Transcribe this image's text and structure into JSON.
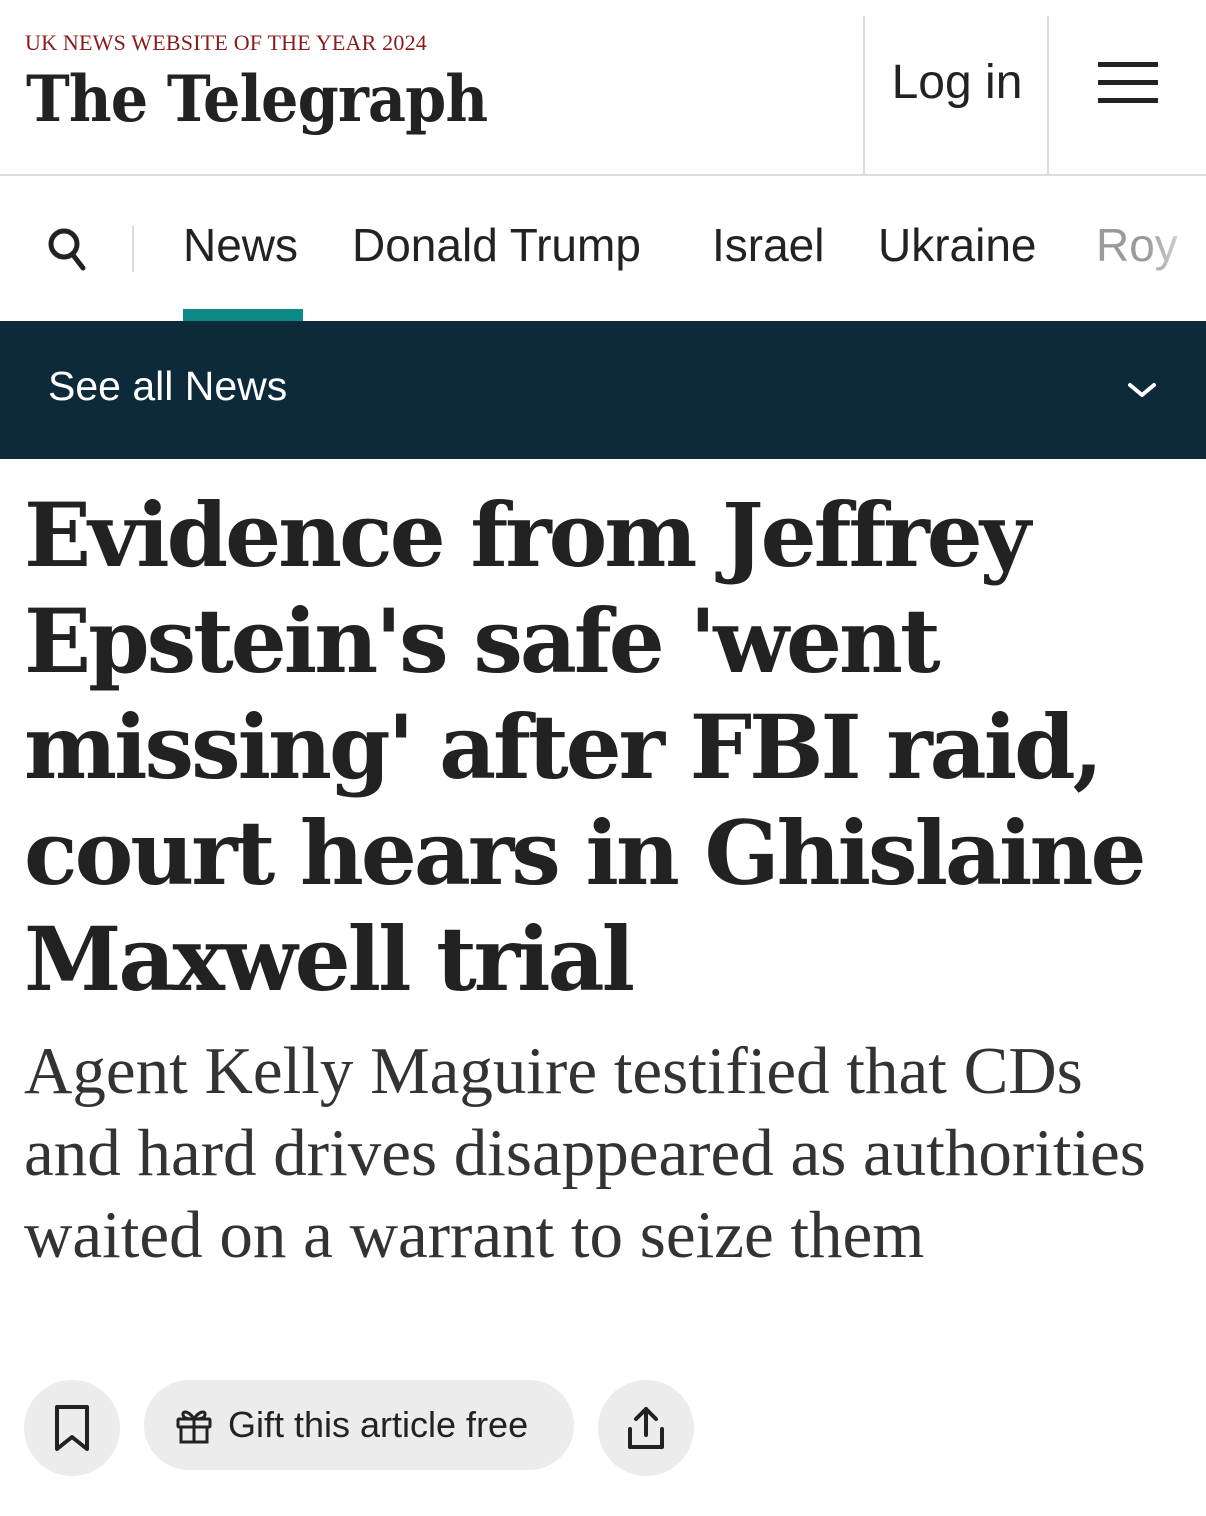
{
  "header": {
    "award": "UK NEWS WEBSITE OF THE YEAR 2024",
    "logo": "The Telegraph",
    "login_label": "Log in",
    "menu_icon": "hamburger-icon"
  },
  "nav": {
    "search_icon": "search-icon",
    "items": [
      {
        "label": "News"
      },
      {
        "label": "Donald Trump"
      },
      {
        "label": "Israel"
      },
      {
        "label": "Ukraine"
      },
      {
        "label": "Roy"
      }
    ],
    "active": "News",
    "accent_color": "#0d8a86"
  },
  "see_all": {
    "label": "See all News",
    "background": "#0d2a3a",
    "icon": "chevron-down-icon"
  },
  "article": {
    "headline": "Evidence from Jeffrey Epstein's safe 'went missing' after FBI raid, court hears in Ghislaine Maxwell trial",
    "standfirst": "Agent Kelly Maguire testified that CDs and hard drives disappeared as authorities waited on a warrant to seize them"
  },
  "actions": {
    "bookmark_icon": "bookmark-icon",
    "gift_icon": "gift-icon",
    "gift_label": "Gift this article free",
    "share_icon": "share-icon"
  }
}
